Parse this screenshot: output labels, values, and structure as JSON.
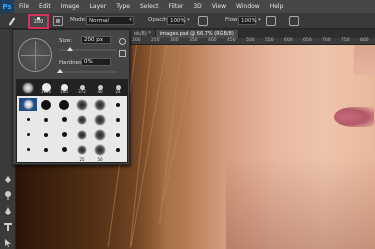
{
  "app": {
    "logo": "Ps"
  },
  "menu": [
    "File",
    "Edit",
    "Image",
    "Layer",
    "Type",
    "Select",
    "Filter",
    "3D",
    "View",
    "Window",
    "Help"
  ],
  "options_bar": {
    "brush_size": "200",
    "mode_label": "Mode:",
    "mode_value": "Normal",
    "opacity_label": "Opacity:",
    "opacity_value": "100%",
    "flow_label": "Flow:",
    "flow_value": "100%"
  },
  "brush_panel": {
    "size_label": "Size:",
    "size_value": "200 px",
    "hardness_label": "Hardness:",
    "hardness_value": "0%",
    "size_fraction": 0.18,
    "hardness_fraction": 0.0,
    "preset_labels": [
      "1065",
      "100",
      "372",
      "40",
      "24"
    ],
    "row_labels": [
      "25",
      "50"
    ]
  },
  "doc": {
    "tabs": [
      "ok/8) *",
      "images.psd @ 66.7% (RGB/8)"
    ],
    "ruler_numbers": [
      "200",
      "250",
      "300",
      "350",
      "400",
      "450",
      "500",
      "550",
      "600",
      "650",
      "700",
      "750",
      "800"
    ]
  }
}
